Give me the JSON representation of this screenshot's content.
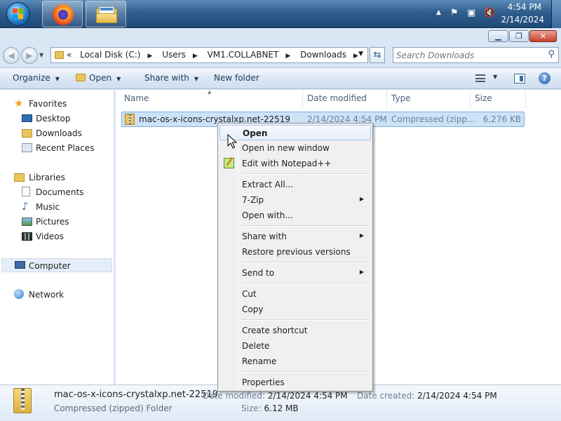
{
  "taskbar": {
    "apps": [
      {
        "name": "Firefox",
        "icon": "firefox-icon"
      },
      {
        "name": "Windows Explorer",
        "icon": "folder-icon"
      }
    ],
    "clock": {
      "time": "4:54 PM",
      "date": "2/14/2024"
    },
    "tray_icons": [
      "chevron-up-icon",
      "action-center-flag-icon",
      "network-icon",
      "volume-muted-icon"
    ]
  },
  "window": {
    "caption_buttons": {
      "minimize": "▁",
      "maximize": "❐",
      "close": "✕"
    }
  },
  "address_bar": {
    "overflow": "«",
    "breadcrumbs": [
      "Local Disk (C:)",
      "Users",
      "VM1.COLLABNET",
      "Downloads"
    ],
    "search_placeholder": "Search Downloads"
  },
  "command_bar": {
    "organize": "Organize",
    "open": "Open",
    "share_with": "Share with",
    "new_folder": "New folder"
  },
  "nav_pane": {
    "favorites": {
      "label": "Favorites",
      "items": [
        "Desktop",
        "Downloads",
        "Recent Places"
      ]
    },
    "libraries": {
      "label": "Libraries",
      "items": [
        "Documents",
        "Music",
        "Pictures",
        "Videos"
      ]
    },
    "computer": "Computer",
    "network": "Network"
  },
  "columns": [
    "Name",
    "Date modified",
    "Type",
    "Size"
  ],
  "files": [
    {
      "name": "mac-os-x-icons-crystalxp.net-22519",
      "date_modified": "2/14/2024 4:54 PM",
      "type": "Compressed (zipp...",
      "size": "6,276 KB"
    }
  ],
  "context_menu": {
    "groups": [
      [
        {
          "label": "Open",
          "bold": true,
          "highlighted": true
        },
        {
          "label": "Open in new window"
        },
        {
          "label": "Edit with Notepad++",
          "icon": "notepad-plus-plus-icon"
        }
      ],
      [
        {
          "label": "Extract All..."
        },
        {
          "label": "7-Zip",
          "submenu": true
        },
        {
          "label": "Open with..."
        }
      ],
      [
        {
          "label": "Share with",
          "submenu": true
        },
        {
          "label": "Restore previous versions"
        }
      ],
      [
        {
          "label": "Send to",
          "submenu": true
        }
      ],
      [
        {
          "label": "Cut"
        },
        {
          "label": "Copy"
        }
      ],
      [
        {
          "label": "Create shortcut"
        },
        {
          "label": "Delete"
        },
        {
          "label": "Rename"
        }
      ],
      [
        {
          "label": "Properties"
        }
      ]
    ]
  },
  "details_pane": {
    "name": "mac-os-x-icons-crystalxp.net-22519",
    "type": "Compressed (zipped) Folder",
    "date_modified_label": "Date modified:",
    "date_modified": "2/14/2024 4:54 PM",
    "date_created_label": "Date created:",
    "date_created": "2/14/2024 4:54 PM",
    "size_label": "Size:",
    "size": "6.12 MB"
  },
  "colors": {
    "selection": "#cce2f7",
    "selection_border": "#84acdd",
    "taskbar": "#2f5d8c",
    "menu_bg": "#f0f0f0"
  }
}
